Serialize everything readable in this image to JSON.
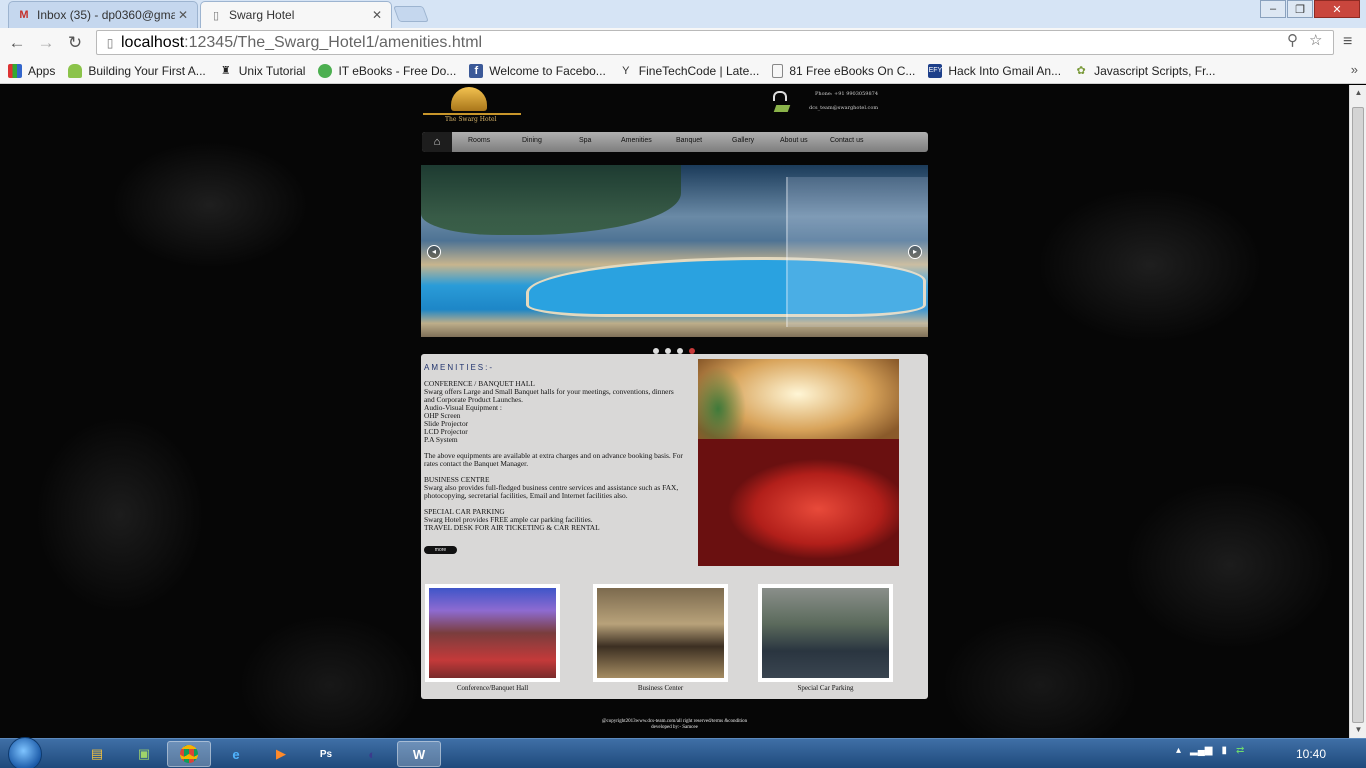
{
  "browser": {
    "tabs": [
      {
        "label": "Inbox (35) - dp0360@gma",
        "icon": "gmail-icon",
        "active": false
      },
      {
        "label": "Swarg Hotel",
        "icon": "page-icon",
        "active": true
      }
    ],
    "url_host": "localhost",
    "url_path": ":12345/The_Swarg_Hotel1/amenities.html",
    "bookmarks": [
      {
        "label": "Apps",
        "icon": "apps-icon"
      },
      {
        "label": "Building Your First A...",
        "icon": "android-icon"
      },
      {
        "label": "Unix Tutorial",
        "icon": "unix-icon"
      },
      {
        "label": "IT eBooks - Free Do...",
        "icon": "ebook-icon"
      },
      {
        "label": "Welcome to Facebo...",
        "icon": "facebook-icon"
      },
      {
        "label": "FineTechCode | Late...",
        "icon": "finetech-icon"
      },
      {
        "label": "81 Free eBooks On C...",
        "icon": "page-icon"
      },
      {
        "label": "Hack Into Gmail An...",
        "icon": "efy-icon"
      },
      {
        "label": "Javascript Scripts, Fr...",
        "icon": "js-icon"
      }
    ]
  },
  "site": {
    "logo_name": "The Swarg Hotel",
    "phone": "Phone:  +91 9903059874",
    "email": "dcs_team@swarghotel.com",
    "nav": [
      "Rooms",
      "Dining",
      "Spa",
      "Amenities",
      "Banquet",
      "Gallery",
      "About us",
      "Contact us"
    ],
    "amenities_title": "AMENITIES:-",
    "paragraphs": [
      "CONFERENCE / BANQUET HALL\nSwarg offers Large and Small Banquet halls for your meetings, conventions, dinners and Corporate Product Launches.\nAudio-Visual Equipment :\nOHP Screen\nSlide Projector\nLCD Projector\nP.A System",
      "The above equipments are available at extra charges and on advance booking basis. For rates contact the Banquet Manager.",
      "BUSINESS CENTRE\nSwarg also provides full-fledged business centre services and assistance such as FAX, photocopying, secretarial facilities, Email and Internet facilities also.",
      "SPECIAL CAR PARKING\nSwarg Hotel provides FREE ample car parking facilities.\nTRAVEL DESK FOR AIR TICKETING & CAR RENTAL"
    ],
    "more_label": "more",
    "thumbnails": [
      {
        "caption": "Conference/Banquet Hall"
      },
      {
        "caption": "Business Center"
      },
      {
        "caption": "Special Car Parking"
      }
    ],
    "footer_line1": "@copyright2013www.dcs-team.com/all right reserved/terms &condition",
    "footer_line2": "developed by:- Samcee"
  },
  "taskbar": {
    "clock": "10:40",
    "apps": [
      "explorer-icon",
      "media-center-icon",
      "chrome-icon",
      "ie-icon",
      "media-player-icon",
      "photoshop-icon",
      "eclipse-icon",
      "word-icon"
    ],
    "active_app": "chrome-icon"
  },
  "colors": {
    "accent_title": "#22346e",
    "content_bg": "#d9d8d7",
    "active_dot": "#c83a3a"
  }
}
